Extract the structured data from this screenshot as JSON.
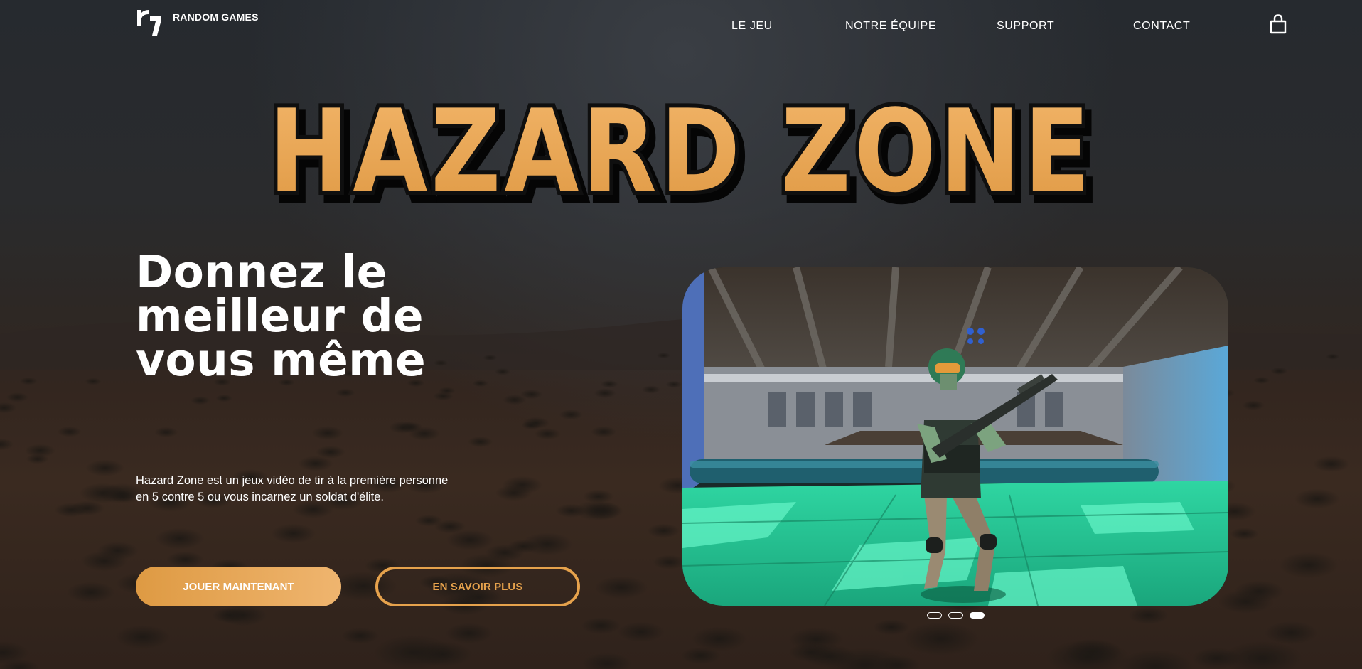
{
  "brand": {
    "logo_icon": "rg-logo-icon",
    "name": "RANDOM GAMES"
  },
  "nav": {
    "items": [
      {
        "label": "LE JEU"
      },
      {
        "label": "NOTRE ÉQUIPE"
      },
      {
        "label": "SUPPORT"
      },
      {
        "label": "CONTACT"
      }
    ],
    "cart_icon": "shopping-bag-icon"
  },
  "hero": {
    "game_title": "HAZARD ZONE",
    "headline_lines": [
      "Donnez le",
      "meilleur de",
      "vous même"
    ],
    "description_lines": [
      "Hazard Zone est un jeux vidéo de tir à la première personne",
      "en 5 contre 5 ou vous incarnez un soldat d'élite."
    ],
    "primary_button": "JOUER MAINTENANT",
    "secondary_button": "EN SAVOIR PLUS"
  },
  "carousel": {
    "slide_count": 3,
    "active_index": 2
  },
  "colors": {
    "accent": "#e6a24c",
    "accent_light": "#efb56f",
    "title_fill": "#e8a452",
    "title_outline": "#111111",
    "text": "#ffffff"
  }
}
